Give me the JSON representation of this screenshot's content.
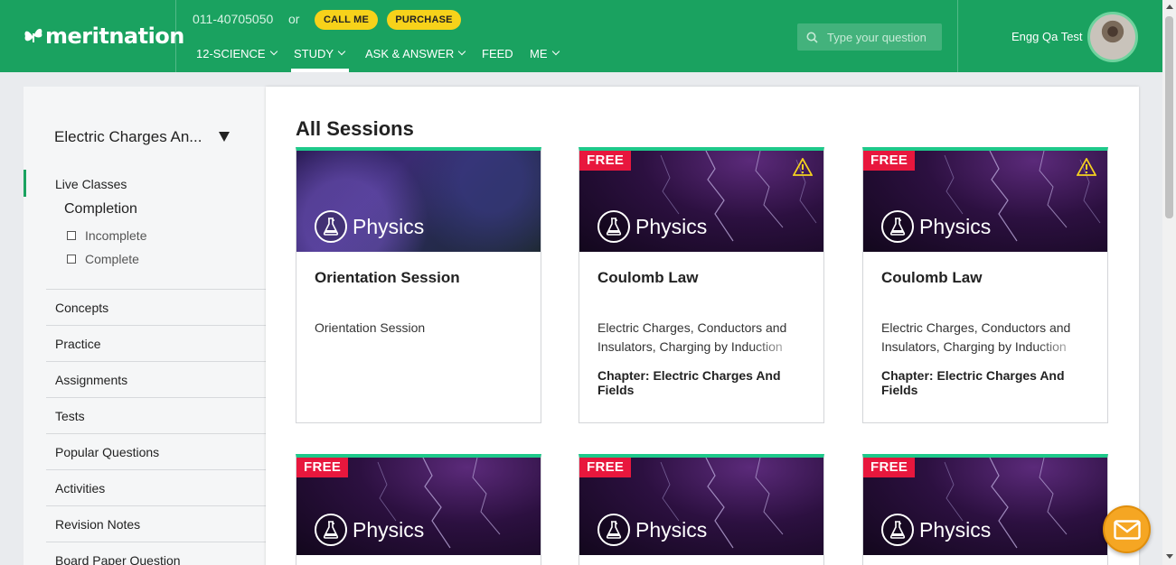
{
  "header": {
    "logo_text": "meritnation",
    "phone": "011-40705050",
    "or_text": "or",
    "call_label": "CALL ME",
    "purchase_label": "PURCHASE",
    "nav": [
      {
        "label": "12-SCIENCE"
      },
      {
        "label": "STUDY"
      },
      {
        "label": "ASK & ANSWER"
      },
      {
        "label": "FEED"
      },
      {
        "label": "ME"
      }
    ],
    "active_nav": "STUDY",
    "search_placeholder": "Type your question",
    "user_name": "Engg Qa Test",
    "accent_color": "#1aa260"
  },
  "sidebar": {
    "chapter": "Electric Charges An...",
    "active_item": "Live Classes",
    "section_heading": "Completion",
    "filters": [
      {
        "label": "Incomplete"
      },
      {
        "label": "Complete"
      }
    ],
    "items": [
      {
        "label": "Concepts"
      },
      {
        "label": "Practice"
      },
      {
        "label": "Assignments"
      },
      {
        "label": "Tests"
      },
      {
        "label": "Popular Questions"
      },
      {
        "label": "Activities"
      },
      {
        "label": "Revision Notes"
      },
      {
        "label": "Board Paper Question"
      }
    ]
  },
  "main": {
    "title": "All Sessions",
    "cards": [
      {
        "subject": "Physics",
        "title": "Orientation Session",
        "description": "Orientation Session",
        "chapter": "",
        "free": false,
        "warning": false
      },
      {
        "subject": "Physics",
        "title": "Coulomb Law",
        "description": "Electric Charges, Conductors and Insulators, Charging by Induction",
        "chapter": "Chapter: Electric Charges And Fields",
        "free": true,
        "free_label": "FREE",
        "warning": true
      },
      {
        "subject": "Physics",
        "title": "Coulomb Law",
        "description": "Electric Charges, Conductors and Insulators, Charging by Induction",
        "chapter": "Chapter: Electric Charges And Fields",
        "free": true,
        "free_label": "FREE",
        "warning": true
      },
      {
        "subject": "Physics",
        "free": true,
        "free_label": "FREE"
      },
      {
        "subject": "Physics",
        "free": true,
        "free_label": "FREE"
      },
      {
        "subject": "Physics",
        "free": true,
        "free_label": "FREE"
      }
    ]
  },
  "chat_icon": "mail-icon"
}
